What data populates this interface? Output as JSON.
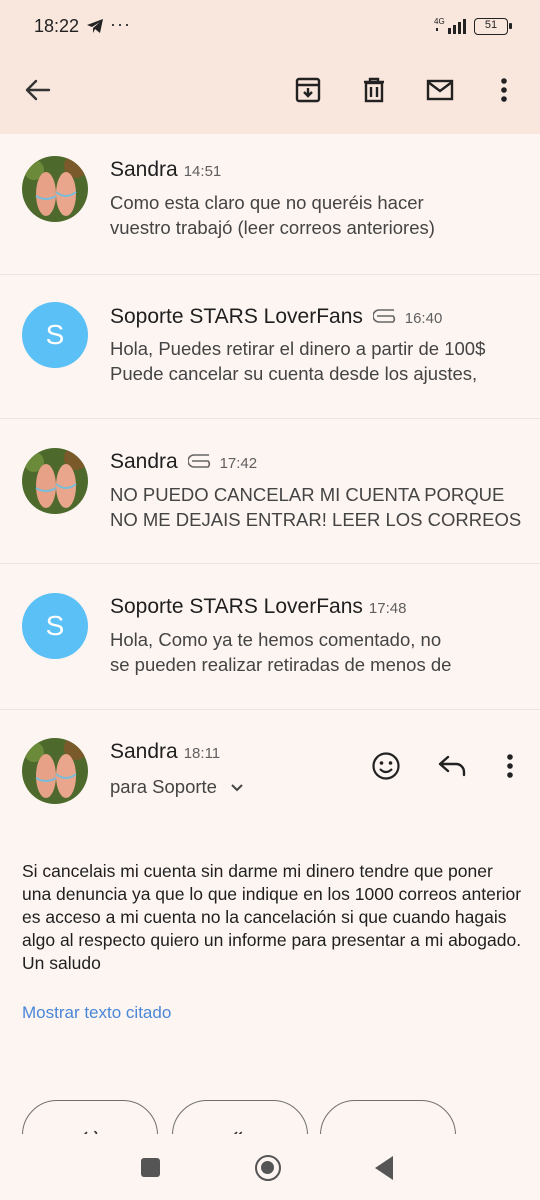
{
  "status_bar": {
    "time": "18:22",
    "dots": "···",
    "network": "4G",
    "battery": "51"
  },
  "toolbar": {
    "back_icon": "arrow-back-icon",
    "archive_icon": "archive-icon",
    "delete_icon": "trash-icon",
    "unread_icon": "mail-icon",
    "more_icon": "more-vert-icon"
  },
  "messages": [
    {
      "sender": "Sandra",
      "time": "14:51",
      "attachment": false,
      "avatar_type": "photo",
      "line1": "Como esta claro que no queréis hacer",
      "line2": "vuestro trabajó (leer correos anteriores)"
    },
    {
      "sender": "Soporte STARS LoverFans",
      "time": "16:40",
      "attachment": true,
      "avatar_type": "letter",
      "avatar_letter": "S",
      "line1": "Hola, Puedes retirar el dinero a partir de 100$",
      "line2": "Puede cancelar su cuenta desde los ajustes,"
    },
    {
      "sender": "Sandra",
      "time": "17:42",
      "attachment": true,
      "avatar_type": "photo",
      "line1": "NO PUEDO CANCELAR MI CUENTA PORQUE",
      "line2": "NO ME DEJAIS ENTRAR! LEER LOS CORREOS"
    },
    {
      "sender": "Soporte STARS LoverFans",
      "time": "17:48",
      "attachment": false,
      "avatar_type": "letter",
      "avatar_letter": "S",
      "line1": "Hola, Como ya te hemos comentado, no",
      "line2": "se pueden realizar retiradas de menos de"
    }
  ],
  "open_message": {
    "sender": "Sandra",
    "time": "18:11",
    "recipient": "para Soporte",
    "body": "Si cancelais mi cuenta sin darme mi dinero tendre que poner una denuncia ya que lo que indique en los 1000 correos anterior es acceso a mi cuenta no la cancelación si que cuando hagais algo al respecto quiero un informe para presentar a mi abogado. Un saludo",
    "show_quoted": "Mostrar texto citado"
  },
  "bottom_actions": [
    {
      "icon": "reply-icon",
      "glyph": "↩"
    },
    {
      "icon": "reply-all-icon",
      "glyph": "↞"
    },
    {
      "icon": "forward-icon",
      "glyph": "→"
    }
  ],
  "colors": {
    "header_bg": "#f9e6dc",
    "page_bg": "#fdf5f2",
    "avatar_blue": "#5bc0f5",
    "link_blue": "#4a87d6"
  }
}
